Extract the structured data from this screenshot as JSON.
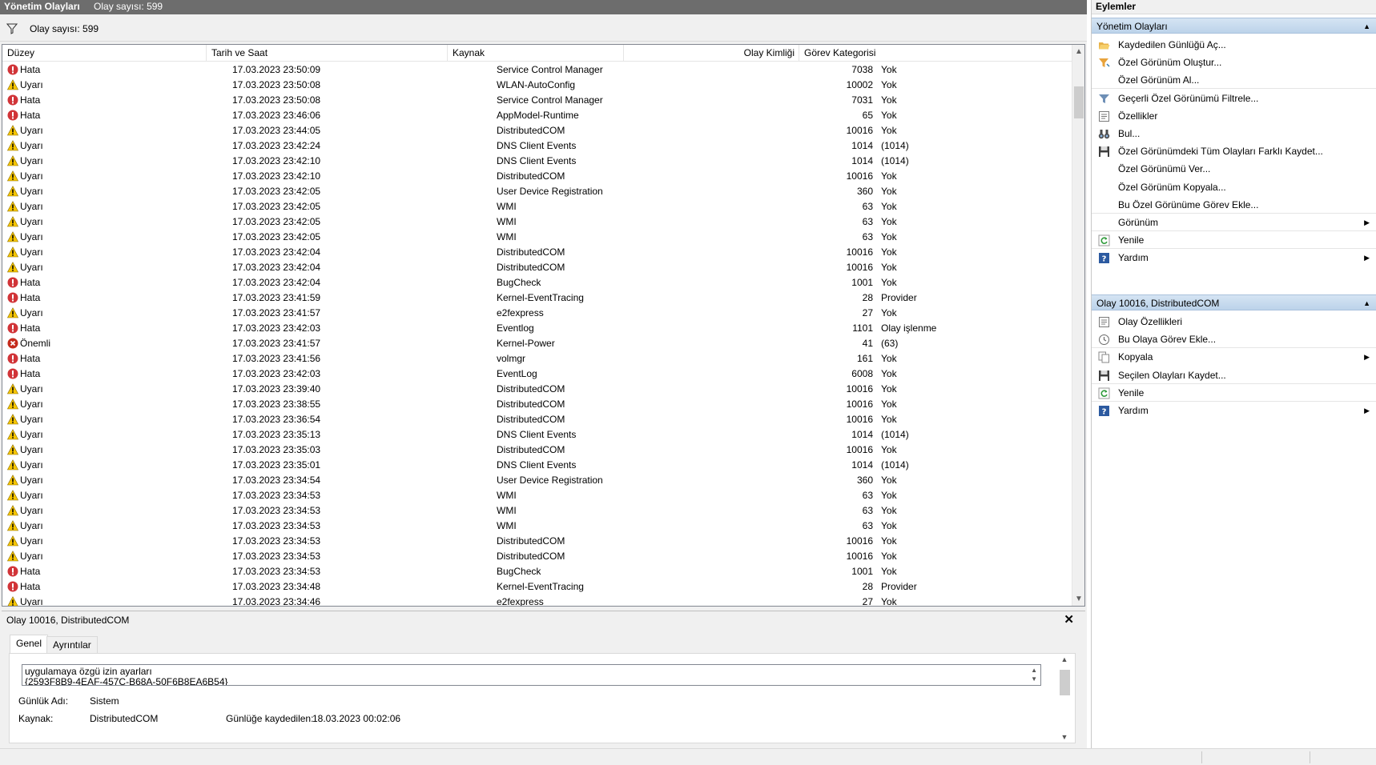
{
  "title_bar": {
    "title": "Yönetim Olayları",
    "count": "Olay sayısı: 599"
  },
  "filter_bar": {
    "text": "Olay sayısı: 599"
  },
  "grid": {
    "columns": [
      "Düzey",
      "Tarih ve Saat",
      "Kaynak",
      "Olay Kimliği",
      "Görev Kategorisi"
    ],
    "rows": [
      {
        "level": "Hata",
        "kind": "error",
        "date": "17.03.2023 23:50:09",
        "source": "Service Control Manager",
        "id": "7038",
        "category": "Yok"
      },
      {
        "level": "Uyarı",
        "kind": "warning",
        "date": "17.03.2023 23:50:08",
        "source": "WLAN-AutoConfig",
        "id": "10002",
        "category": "Yok"
      },
      {
        "level": "Hata",
        "kind": "error",
        "date": "17.03.2023 23:50:08",
        "source": "Service Control Manager",
        "id": "7031",
        "category": "Yok"
      },
      {
        "level": "Hata",
        "kind": "error",
        "date": "17.03.2023 23:46:06",
        "source": "AppModel-Runtime",
        "id": "65",
        "category": "Yok"
      },
      {
        "level": "Uyarı",
        "kind": "warning",
        "date": "17.03.2023 23:44:05",
        "source": "DistributedCOM",
        "id": "10016",
        "category": "Yok"
      },
      {
        "level": "Uyarı",
        "kind": "warning",
        "date": "17.03.2023 23:42:24",
        "source": "DNS Client Events",
        "id": "1014",
        "category": "(1014)"
      },
      {
        "level": "Uyarı",
        "kind": "warning",
        "date": "17.03.2023 23:42:10",
        "source": "DNS Client Events",
        "id": "1014",
        "category": "(1014)"
      },
      {
        "level": "Uyarı",
        "kind": "warning",
        "date": "17.03.2023 23:42:10",
        "source": "DistributedCOM",
        "id": "10016",
        "category": "Yok"
      },
      {
        "level": "Uyarı",
        "kind": "warning",
        "date": "17.03.2023 23:42:05",
        "source": "User Device Registration",
        "id": "360",
        "category": "Yok"
      },
      {
        "level": "Uyarı",
        "kind": "warning",
        "date": "17.03.2023 23:42:05",
        "source": "WMI",
        "id": "63",
        "category": "Yok"
      },
      {
        "level": "Uyarı",
        "kind": "warning",
        "date": "17.03.2023 23:42:05",
        "source": "WMI",
        "id": "63",
        "category": "Yok"
      },
      {
        "level": "Uyarı",
        "kind": "warning",
        "date": "17.03.2023 23:42:05",
        "source": "WMI",
        "id": "63",
        "category": "Yok"
      },
      {
        "level": "Uyarı",
        "kind": "warning",
        "date": "17.03.2023 23:42:04",
        "source": "DistributedCOM",
        "id": "10016",
        "category": "Yok"
      },
      {
        "level": "Uyarı",
        "kind": "warning",
        "date": "17.03.2023 23:42:04",
        "source": "DistributedCOM",
        "id": "10016",
        "category": "Yok"
      },
      {
        "level": "Hata",
        "kind": "error",
        "date": "17.03.2023 23:42:04",
        "source": "BugCheck",
        "id": "1001",
        "category": "Yok"
      },
      {
        "level": "Hata",
        "kind": "error",
        "date": "17.03.2023 23:41:59",
        "source": "Kernel-EventTracing",
        "id": "28",
        "category": "Provider"
      },
      {
        "level": "Uyarı",
        "kind": "warning",
        "date": "17.03.2023 23:41:57",
        "source": "e2fexpress",
        "id": "27",
        "category": "Yok"
      },
      {
        "level": "Hata",
        "kind": "error",
        "date": "17.03.2023 23:42:03",
        "source": "Eventlog",
        "id": "1101",
        "category": "Olay işlenme"
      },
      {
        "level": "Önemli",
        "kind": "critical",
        "date": "17.03.2023 23:41:57",
        "source": "Kernel-Power",
        "id": "41",
        "category": "(63)"
      },
      {
        "level": "Hata",
        "kind": "error",
        "date": "17.03.2023 23:41:56",
        "source": "volmgr",
        "id": "161",
        "category": "Yok"
      },
      {
        "level": "Hata",
        "kind": "error",
        "date": "17.03.2023 23:42:03",
        "source": "EventLog",
        "id": "6008",
        "category": "Yok"
      },
      {
        "level": "Uyarı",
        "kind": "warning",
        "date": "17.03.2023 23:39:40",
        "source": "DistributedCOM",
        "id": "10016",
        "category": "Yok"
      },
      {
        "level": "Uyarı",
        "kind": "warning",
        "date": "17.03.2023 23:38:55",
        "source": "DistributedCOM",
        "id": "10016",
        "category": "Yok"
      },
      {
        "level": "Uyarı",
        "kind": "warning",
        "date": "17.03.2023 23:36:54",
        "source": "DistributedCOM",
        "id": "10016",
        "category": "Yok"
      },
      {
        "level": "Uyarı",
        "kind": "warning",
        "date": "17.03.2023 23:35:13",
        "source": "DNS Client Events",
        "id": "1014",
        "category": "(1014)"
      },
      {
        "level": "Uyarı",
        "kind": "warning",
        "date": "17.03.2023 23:35:03",
        "source": "DistributedCOM",
        "id": "10016",
        "category": "Yok"
      },
      {
        "level": "Uyarı",
        "kind": "warning",
        "date": "17.03.2023 23:35:01",
        "source": "DNS Client Events",
        "id": "1014",
        "category": "(1014)"
      },
      {
        "level": "Uyarı",
        "kind": "warning",
        "date": "17.03.2023 23:34:54",
        "source": "User Device Registration",
        "id": "360",
        "category": "Yok"
      },
      {
        "level": "Uyarı",
        "kind": "warning",
        "date": "17.03.2023 23:34:53",
        "source": "WMI",
        "id": "63",
        "category": "Yok"
      },
      {
        "level": "Uyarı",
        "kind": "warning",
        "date": "17.03.2023 23:34:53",
        "source": "WMI",
        "id": "63",
        "category": "Yok"
      },
      {
        "level": "Uyarı",
        "kind": "warning",
        "date": "17.03.2023 23:34:53",
        "source": "WMI",
        "id": "63",
        "category": "Yok"
      },
      {
        "level": "Uyarı",
        "kind": "warning",
        "date": "17.03.2023 23:34:53",
        "source": "DistributedCOM",
        "id": "10016",
        "category": "Yok"
      },
      {
        "level": "Uyarı",
        "kind": "warning",
        "date": "17.03.2023 23:34:53",
        "source": "DistributedCOM",
        "id": "10016",
        "category": "Yok"
      },
      {
        "level": "Hata",
        "kind": "error",
        "date": "17.03.2023 23:34:53",
        "source": "BugCheck",
        "id": "1001",
        "category": "Yok"
      },
      {
        "level": "Hata",
        "kind": "error",
        "date": "17.03.2023 23:34:48",
        "source": "Kernel-EventTracing",
        "id": "28",
        "category": "Provider"
      },
      {
        "level": "Uyarı",
        "kind": "warning",
        "date": "17.03.2023 23:34:46",
        "source": "e2fexpress",
        "id": "27",
        "category": "Yok"
      }
    ]
  },
  "details": {
    "title": "Olay 10016, DistributedCOM",
    "close": "✕",
    "tabs": [
      "Genel",
      "Ayrıntılar"
    ],
    "description_line1": "uygulamaya özgü izin ayarları",
    "description_line2": "{2593F8B9-4EAF-457C-B68A-50F6B8EA6B54}",
    "log_name_label": "Günlük Adı:",
    "log_name_value": "Sistem",
    "source_label": "Kaynak:",
    "source_value": "DistributedCOM",
    "logged_label": "Günlüğe kaydedilen:",
    "logged_value": "18.03.2023 00:02:06"
  },
  "actions": {
    "header": "Eylemler",
    "section1": {
      "title": "Yönetim Olayları",
      "items": [
        {
          "label": "Kaydedilen Günlüğü Aç...",
          "icon": "folder-open-icon"
        },
        {
          "label": "Özel Görünüm Oluştur...",
          "icon": "filter-create-icon"
        },
        {
          "label": "Özel Görünüm Al...",
          "icon": ""
        },
        {
          "label": "Geçerli Özel Görünümü Filtrele...",
          "icon": "filter-icon"
        },
        {
          "label": "Özellikler",
          "icon": "properties-icon"
        },
        {
          "label": "Bul...",
          "icon": "binoculars-icon"
        },
        {
          "label": "Özel Görünümdeki Tüm Olayları Farklı Kaydet...",
          "icon": "save-icon"
        },
        {
          "label": "Özel Görünümü Ver...",
          "icon": ""
        },
        {
          "label": "Özel Görünüm Kopyala...",
          "icon": ""
        },
        {
          "label": "Bu Özel Görünüme Görev Ekle...",
          "icon": ""
        },
        {
          "label": "Görünüm",
          "icon": ""
        },
        {
          "label": "Yenile",
          "icon": "refresh-icon"
        },
        {
          "label": "Yardım",
          "icon": "help-icon"
        }
      ]
    },
    "section2": {
      "title": "Olay 10016, DistributedCOM",
      "items": [
        {
          "label": "Olay Özellikleri",
          "icon": "properties-icon"
        },
        {
          "label": "Bu Olaya Görev Ekle...",
          "icon": "task-icon"
        },
        {
          "label": "Kopyala",
          "icon": "copy-icon"
        },
        {
          "label": "Seçilen Olayları Kaydet...",
          "icon": "save-icon"
        },
        {
          "label": "Yenile",
          "icon": "refresh-icon"
        },
        {
          "label": "Yardım",
          "icon": "help-icon"
        }
      ]
    }
  },
  "colors": {
    "error": "#d13438",
    "warning": "#f7c600",
    "critical": "#c42b1c",
    "section_head": "#c6d9ee",
    "title_bar": "#6d6d6d"
  }
}
